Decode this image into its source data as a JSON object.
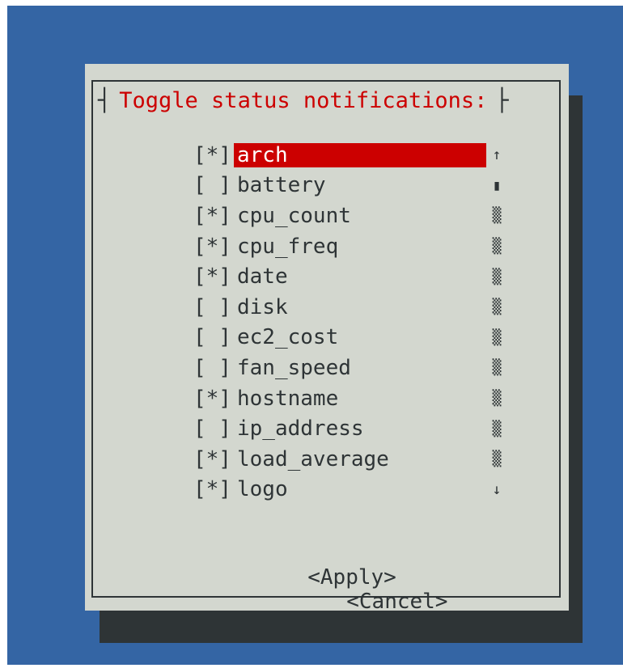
{
  "dialog": {
    "title": "Toggle status notifications:",
    "title_left_tick": "┤",
    "title_right_tick": "├"
  },
  "items": [
    {
      "mark": "[*]",
      "label": "arch",
      "selected": true
    },
    {
      "mark": "[ ]",
      "label": "battery"
    },
    {
      "mark": "[*]",
      "label": "cpu_count"
    },
    {
      "mark": "[*]",
      "label": "cpu_freq"
    },
    {
      "mark": "[*]",
      "label": "date"
    },
    {
      "mark": "[ ]",
      "label": "disk"
    },
    {
      "mark": "[ ]",
      "label": "ec2_cost"
    },
    {
      "mark": "[ ]",
      "label": "fan_speed"
    },
    {
      "mark": "[*]",
      "label": "hostname"
    },
    {
      "mark": "[ ]",
      "label": "ip_address"
    },
    {
      "mark": "[*]",
      "label": "load_average"
    },
    {
      "mark": "[*]",
      "label": "logo"
    }
  ],
  "scrollbar": [
    "↑",
    "▮",
    "▒",
    "▒",
    "▒",
    "▒",
    "▒",
    "▒",
    "▒",
    "▒",
    "▒",
    "↓"
  ],
  "buttons": {
    "apply": "<Apply>",
    "cancel": "<Cancel>"
  },
  "colors": {
    "desktop": "#3465a4",
    "dialog": "#d3d7cf",
    "shadow": "#2e3436",
    "accent": "#cc0000"
  }
}
